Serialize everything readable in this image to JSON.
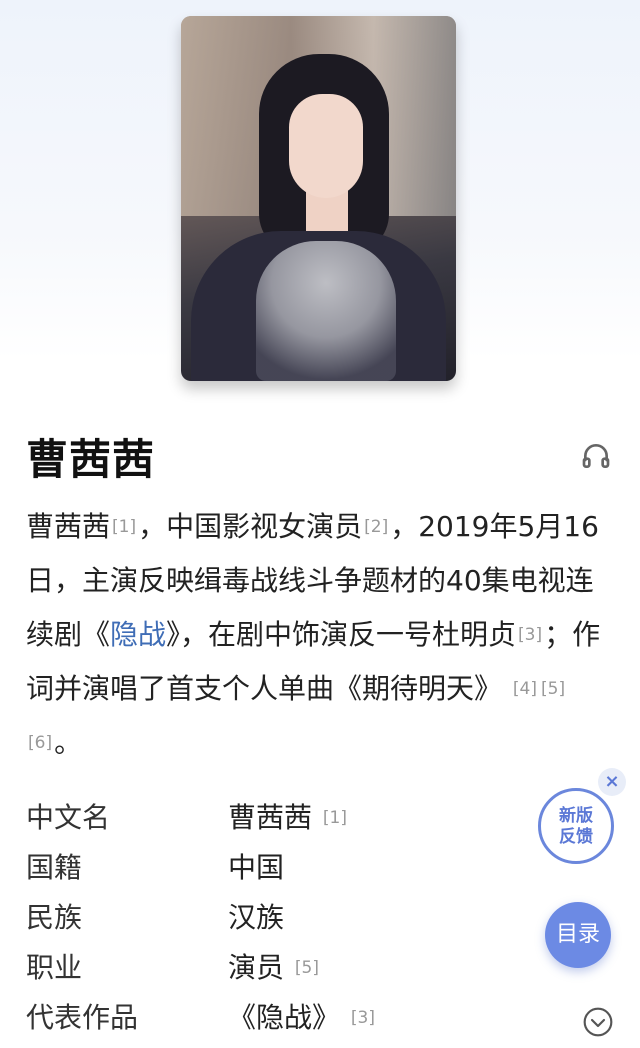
{
  "person": {
    "title": "曹茜茜"
  },
  "summary": {
    "name": "曹茜茜",
    "ref1": "[1]",
    "part1": "，中国影视女演员",
    "ref2": "[2]",
    "part2": "，2019年5月16日，主演反映缉毒战线斗争题材的40集电视连续剧《",
    "link_show": "隐战",
    "part3": "》，在剧中饰演反一号杜明贞",
    "ref3": "[3]",
    "part4": "；作词并演唱了首支个人单曲《期待明天》",
    "ref4": "[4]",
    "ref5": "[5]",
    "ref6": "[6]",
    "end": "。"
  },
  "infobox": [
    {
      "key": "中文名",
      "value": "曹茜茜",
      "ref": "[1]"
    },
    {
      "key": "国籍",
      "value": "中国",
      "ref": ""
    },
    {
      "key": "民族",
      "value": "汉族",
      "ref": ""
    },
    {
      "key": "职业",
      "value": "演员",
      "ref": "[5]"
    },
    {
      "key": "代表作品",
      "value": "《隐战》",
      "ref": "[3]"
    }
  ],
  "floating": {
    "feedback_line1": "新版",
    "feedback_line2": "反馈",
    "close": "×",
    "toc": "目录"
  },
  "icons": {
    "listen": "headphones-icon",
    "expand": "chevron-down-circle-icon"
  },
  "colors": {
    "link": "#3f6db6",
    "accent": "#6c8ae4"
  }
}
